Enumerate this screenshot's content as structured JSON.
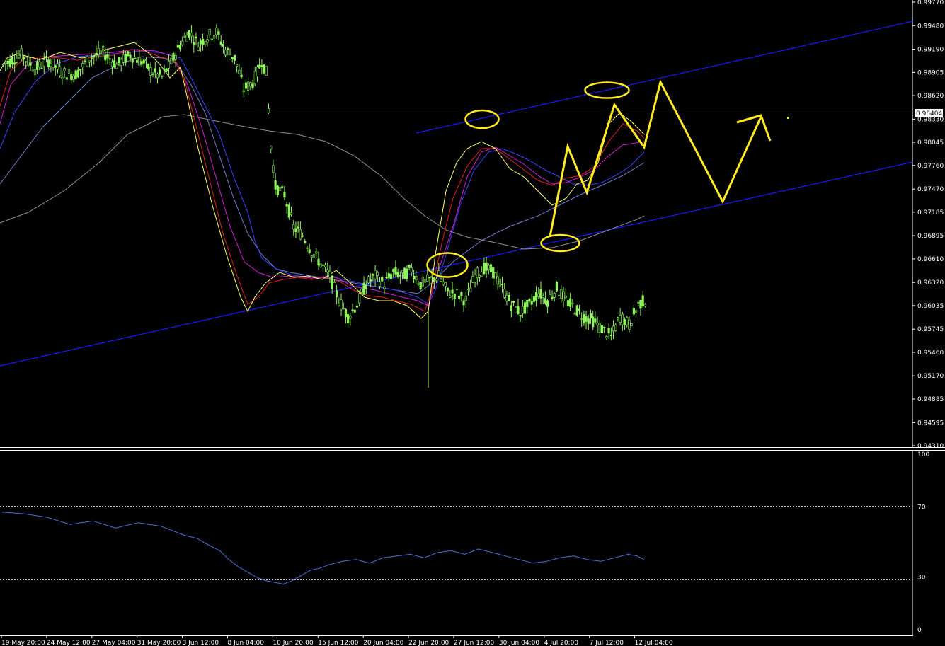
{
  "chart_data": {
    "type": "candlestick-with-indicators",
    "colors": {
      "background": "#000000",
      "foreground": "#ffffff",
      "candle": "#8ef65a",
      "channel": "#1a1aff",
      "annotation": "#ffea1f",
      "ma_yellow": "#ffff66",
      "ma_red": "#e02020",
      "ma_magenta": "#d020d0",
      "ma_blue": "#3a40ff",
      "ma_slow_blue": "#707cc0",
      "ma_gray": "#909090",
      "rsi": "#4a70d8",
      "grid": "#c8c8c8"
    },
    "price_axis": {
      "ylim": [
        0.9431,
        0.9977
      ],
      "ticks": [
        "0.99770",
        "0.99480",
        "0.99190",
        "0.98905",
        "0.98620",
        "0.98330",
        "0.98045",
        "0.97760",
        "0.97470",
        "0.97185",
        "0.96895",
        "0.96610",
        "0.96320",
        "0.96035",
        "0.95745",
        "0.95460",
        "0.95170",
        "0.94885",
        "0.94595",
        "0.94310"
      ],
      "current_price": "0.98404",
      "current_value": 0.98404
    },
    "time_axis": {
      "labels": [
        "19 May 20:00",
        "24 May 12:00",
        "27 May 04:00",
        "31 May 20:00",
        "3 Jun 12:00",
        "8 Jun 04:00",
        "10 Jun 20:00",
        "15 Jun 12:00",
        "20 Jun 04:00",
        "22 Jun 20:00",
        "27 Jun 12:00",
        "30 Jun 04:00",
        "4 Jul 20:00",
        "7 Jul 12:00",
        "12 Jul 04:00"
      ],
      "bars": 284
    },
    "price_path": [
      [
        0,
        0.99
      ],
      [
        8,
        0.9912
      ],
      [
        14,
        0.9895
      ],
      [
        20,
        0.9905
      ],
      [
        26,
        0.989
      ],
      [
        32,
        0.9888
      ],
      [
        38,
        0.9908
      ],
      [
        44,
        0.9915
      ],
      [
        50,
        0.99
      ],
      [
        56,
        0.9912
      ],
      [
        62,
        0.9902
      ],
      [
        66,
        0.989
      ],
      [
        70,
        0.9885
      ],
      [
        74,
        0.9902
      ],
      [
        78,
        0.9925
      ],
      [
        82,
        0.994
      ],
      [
        86,
        0.9925
      ],
      [
        90,
        0.9935
      ],
      [
        94,
        0.994
      ],
      [
        98,
        0.9918
      ],
      [
        102,
        0.9908
      ],
      [
        104,
        0.989
      ],
      [
        106,
        0.987
      ],
      [
        110,
        0.9878
      ],
      [
        112,
        0.989
      ],
      [
        114,
        0.9905
      ],
      [
        116,
        0.989
      ],
      [
        118,
        0.98
      ],
      [
        120,
        0.975
      ],
      [
        124,
        0.974
      ],
      [
        128,
        0.97
      ],
      [
        132,
        0.969
      ],
      [
        136,
        0.967
      ],
      [
        140,
        0.9655
      ],
      [
        144,
        0.964
      ],
      [
        148,
        0.961
      ],
      [
        152,
        0.959
      ],
      [
        156,
        0.9605
      ],
      [
        160,
        0.963
      ],
      [
        164,
        0.964
      ],
      [
        168,
        0.963
      ],
      [
        172,
        0.9645
      ],
      [
        176,
        0.964
      ],
      [
        180,
        0.9648
      ],
      [
        184,
        0.963
      ],
      [
        188,
        0.9635
      ],
      [
        192,
        0.964
      ],
      [
        196,
        0.962
      ],
      [
        200,
        0.9618
      ],
      [
        204,
        0.961
      ],
      [
        208,
        0.964
      ],
      [
        212,
        0.965
      ],
      [
        216,
        0.9645
      ],
      [
        220,
        0.9625
      ],
      [
        224,
        0.9605
      ],
      [
        228,
        0.9595
      ],
      [
        232,
        0.9605
      ],
      [
        236,
        0.962
      ],
      [
        240,
        0.961
      ],
      [
        244,
        0.9625
      ],
      [
        248,
        0.961
      ],
      [
        252,
        0.96
      ],
      [
        256,
        0.959
      ],
      [
        260,
        0.9585
      ],
      [
        264,
        0.9575
      ],
      [
        268,
        0.9565
      ],
      [
        272,
        0.959
      ],
      [
        276,
        0.958
      ],
      [
        280,
        0.9605
      ],
      [
        283,
        0.961
      ]
    ],
    "rsi": {
      "ylim": [
        0,
        100
      ],
      "levels": [
        70,
        30
      ],
      "ticks": [
        "100",
        "70",
        "30",
        "0"
      ],
      "path": [
        [
          0,
          67
        ],
        [
          10,
          66
        ],
        [
          20,
          64
        ],
        [
          30,
          60
        ],
        [
          40,
          62
        ],
        [
          50,
          58
        ],
        [
          60,
          61
        ],
        [
          70,
          59
        ],
        [
          80,
          54
        ],
        [
          86,
          52
        ],
        [
          90,
          49
        ],
        [
          96,
          45
        ],
        [
          100,
          40
        ],
        [
          104,
          36
        ],
        [
          108,
          33
        ],
        [
          112,
          30
        ],
        [
          116,
          28
        ],
        [
          120,
          27
        ],
        [
          124,
          26
        ],
        [
          128,
          28
        ],
        [
          132,
          31
        ],
        [
          136,
          34
        ],
        [
          140,
          35
        ],
        [
          144,
          37
        ],
        [
          150,
          39
        ],
        [
          156,
          40
        ],
        [
          162,
          38
        ],
        [
          168,
          41
        ],
        [
          174,
          42
        ],
        [
          180,
          43
        ],
        [
          186,
          41
        ],
        [
          192,
          44
        ],
        [
          198,
          45
        ],
        [
          204,
          43
        ],
        [
          210,
          46
        ],
        [
          216,
          44
        ],
        [
          222,
          42
        ],
        [
          228,
          40
        ],
        [
          234,
          38
        ],
        [
          240,
          39
        ],
        [
          246,
          41
        ],
        [
          252,
          42
        ],
        [
          258,
          40
        ],
        [
          264,
          39
        ],
        [
          270,
          41
        ],
        [
          276,
          43
        ],
        [
          280,
          42
        ],
        [
          283,
          40
        ]
      ]
    },
    "annotations": [
      {
        "type": "ellipse",
        "bar": 148.7,
        "price": 0.9664,
        "rx": 0.97,
        "ry": 0.0009
      },
      {
        "type": "ellipse",
        "bar": 182.7,
        "price": 0.98365,
        "rx": 0.8,
        "ry": 0.0007
      },
      {
        "type": "ellipse",
        "bar": 214.8,
        "price": 0.96885,
        "rx": 0.93,
        "ry": 0.0006
      },
      {
        "type": "ellipse",
        "bar": 196.4,
        "price": 0.98755,
        "rx": 1.1,
        "ry": 0.00062
      }
    ]
  },
  "price_tags": {
    "current": "0.98404"
  }
}
